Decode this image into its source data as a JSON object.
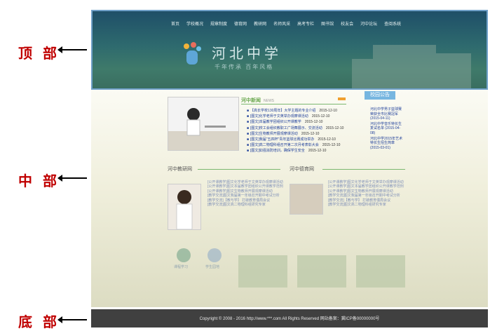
{
  "annotations": {
    "top": "顶 部",
    "middle": "中 部",
    "bottom": "底 部"
  },
  "header": {
    "nav": [
      "首页",
      "学校概况",
      "规章制度",
      "德育网",
      "教研网",
      "名师风采",
      "高考专栏",
      "图书馆",
      "校友会",
      "河中论坛",
      "查阅系统"
    ],
    "school_name": "河北中学",
    "motto": "千年传承  百年风格"
  },
  "news": {
    "title": "河中新闻",
    "subtitle": "NEWS",
    "items": [
      {
        "text": "【高长学校130周年】大学主题的专业介绍",
        "date": "2015-12-10"
      },
      {
        "text": "[图文]化学老师于文英举办观摩课活动",
        "date": "2015-12-10"
      },
      {
        "text": "[图文]本届教学团组织公开课教学",
        "date": "2015-12-10"
      },
      {
        "text": "[图文]校工会组织教职工广场舞展示、交流活动",
        "date": "2015-12-10"
      },
      {
        "text": "[图文]生物教师开展观摩课活动",
        "date": "2015-12-10"
      },
      {
        "text": "[图文]我届\"五四杯\"青年篮球比赛成功举办",
        "date": "2015-12-10"
      },
      {
        "text": "[图文]高二物理科组召开第二次月考表彰大会",
        "date": "2015-12-10"
      },
      {
        "text": "[图文]如强消防培训，确保学生安全",
        "date": "2015-12-10"
      }
    ]
  },
  "notice": {
    "title": "校园公告",
    "items": [
      "河北中学男子篮球赛荣获全市比赛冠军 (2015-04-11)",
      "河北中学音乐特长生复试名单 (2015-04-08)",
      "河北中学2015年艺术特长生招生简章 (2015-03-01)"
    ]
  },
  "teaching": {
    "title": "河中教研网",
    "items": [
      "[公开课教学]图文化学老师于文英举办观摩课活动",
      "[公开课教学]图文本届教学团组织公开课教学范例",
      "[公开课教学]图文生物教师开展观摩课活动",
      "[教学交流]图文我届第一年级召开期中考试分析",
      "[教学交流]【教与学】 打破教育僵局会议",
      "[教学交流]图文高二物理科组研究专家"
    ]
  },
  "moral": {
    "title": "河中德育网",
    "items": [
      "[公开课教学]图文化学老师于文英举办观摩课活动",
      "[公开课教学]图文本届教学团组织公开课教学范例",
      "[公开课教学]图文生物教师开展观摩课活动",
      "[教学交流]图文我届第一年级召开期中考试分析",
      "[教学交流]【教与学】 打破教育僵局会议",
      "[教学交流]图文高二物理科组研究专家"
    ]
  },
  "quick_links": [
    "课程学习",
    "学生园地"
  ],
  "footer": {
    "copyright": "Copyright © 2008 - 2016 http://www.***.com All Rights Reserved 网站备案：冀ICP备00000000号"
  },
  "colors": {
    "header": "#2e6a6e",
    "footer": "#404040",
    "accent": "#6aa84f",
    "link": "#1f3f9a",
    "annotation": "#c00000"
  }
}
